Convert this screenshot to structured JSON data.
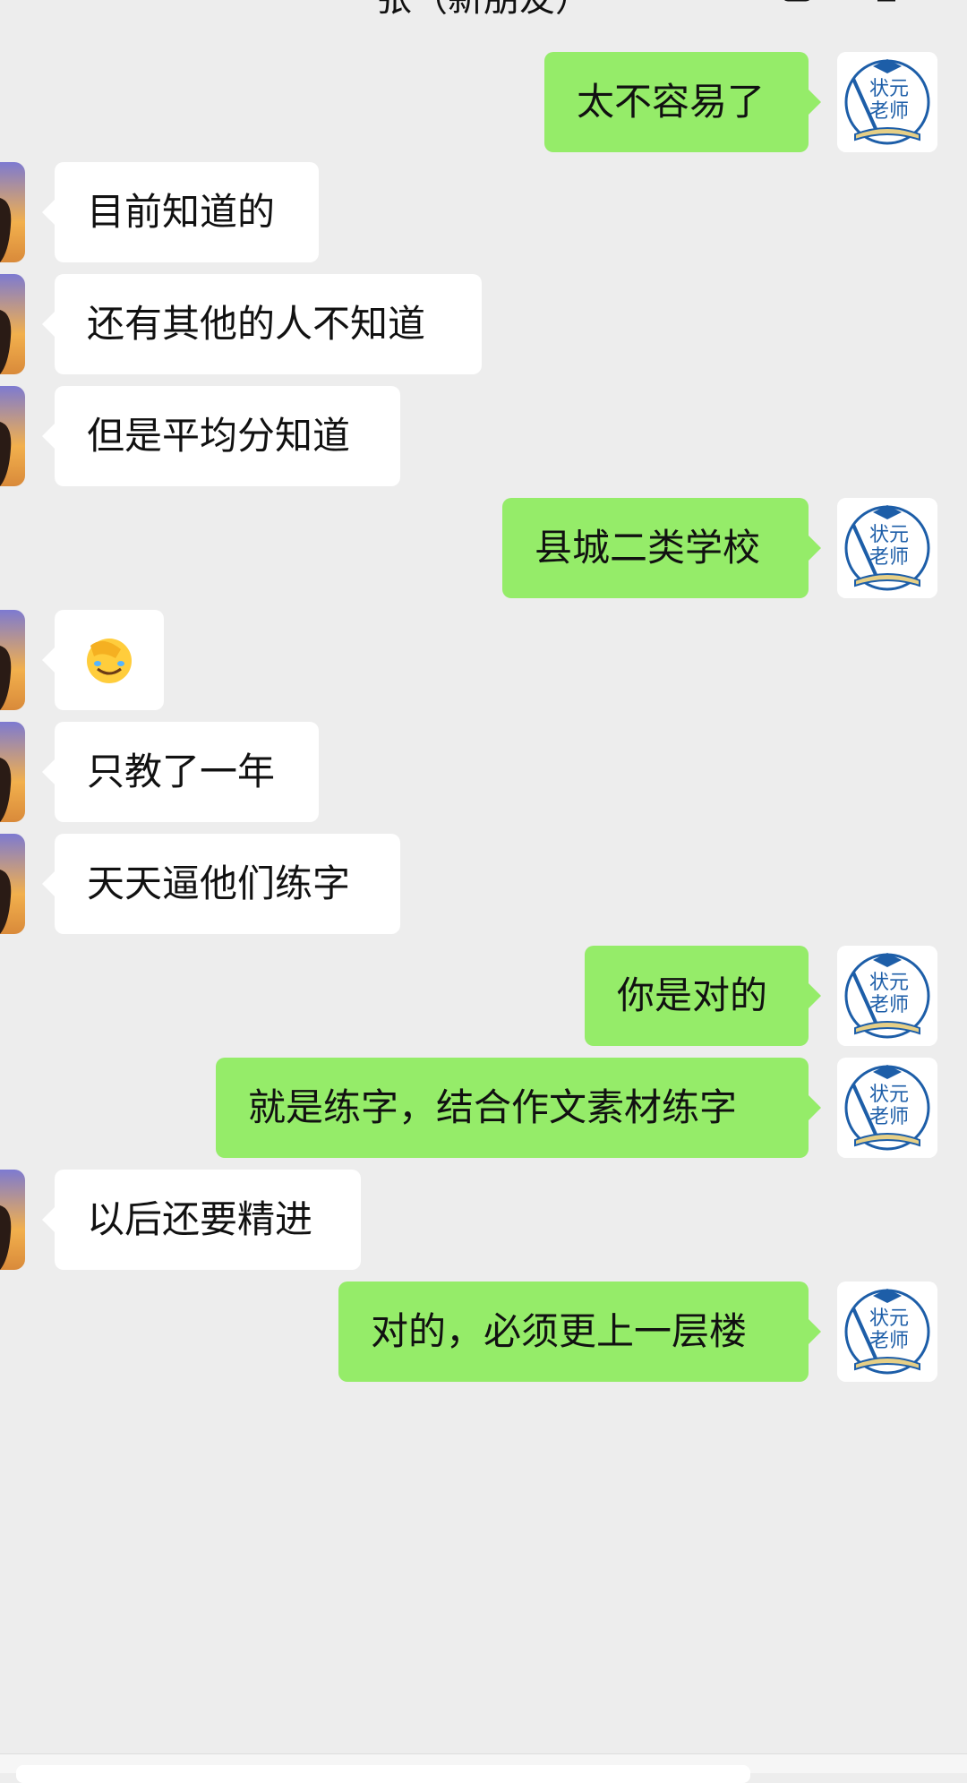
{
  "header": {
    "title": "张（新朋友）",
    "more_icon": "more-icon",
    "call_icon": "call-icon"
  },
  "avatars": {
    "self_text_line1": "状元",
    "self_text_line2": "老师",
    "self_accent": "#1d5ea8",
    "other_gradient_top": "#7d7ad1",
    "other_gradient_bottom": "#d98a3a"
  },
  "messages": [
    {
      "side": "out",
      "text": "太不容易了"
    },
    {
      "side": "in",
      "text": "目前知道的"
    },
    {
      "side": "in",
      "text": "还有其他的人不知道"
    },
    {
      "side": "in",
      "text": "但是平均分知道"
    },
    {
      "side": "out",
      "text": "县城二类学校"
    },
    {
      "side": "in",
      "text": "",
      "emoji": "facepalm-emoji"
    },
    {
      "side": "in",
      "text": "只教了一年"
    },
    {
      "side": "in",
      "text": "天天逼他们练字"
    },
    {
      "side": "out",
      "text": "你是对的"
    },
    {
      "side": "out",
      "text": "就是练字，结合作文素材练字"
    },
    {
      "side": "in",
      "text": "以后还要精进"
    },
    {
      "side": "out",
      "text": "对的，必须更上一层楼"
    }
  ],
  "colors": {
    "background": "#ededed",
    "outgoing_bubble": "#95ec69",
    "incoming_bubble": "#ffffff"
  }
}
